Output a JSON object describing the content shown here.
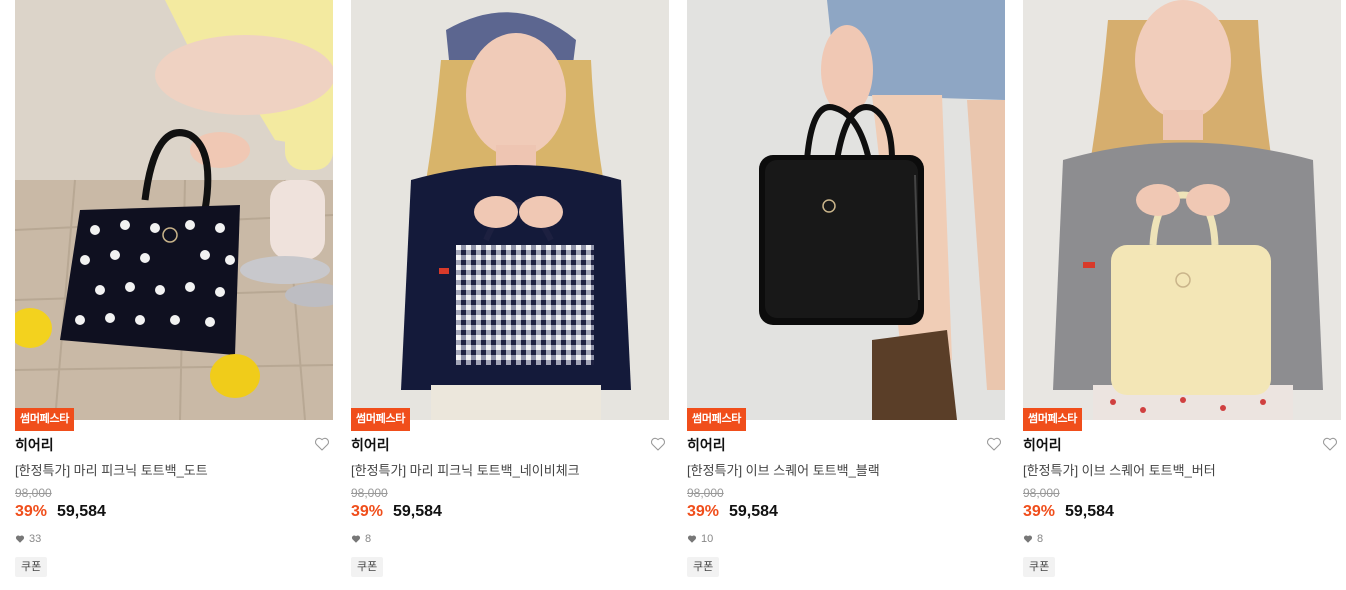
{
  "products": [
    {
      "badge": "썸머페스타",
      "brand": "히어리",
      "name": "[한정특가] 마리 피크닉 토트백_도트",
      "original_price": "98,000",
      "discount": "39%",
      "price": "59,584",
      "likes": "33",
      "coupon": "쿠폰",
      "image": "model crouching holding navy polka-dot tote bag with lemons on tile floor"
    },
    {
      "badge": "썸머페스타",
      "brand": "히어리",
      "name": "[한정특가] 마리 피크닉 토트백_네이비체크",
      "original_price": "98,000",
      "discount": "39%",
      "price": "59,584",
      "likes": "8",
      "coupon": "쿠폰",
      "image": "winking model in navy cardigan holding gingham check tote bag"
    },
    {
      "badge": "썸머페스타",
      "brand": "히어리",
      "name": "[한정특가] 이브 스퀘어 토트백_블랙",
      "original_price": "98,000",
      "discount": "39%",
      "price": "59,584",
      "likes": "10",
      "coupon": "쿠폰",
      "image": "hand holding black square leather tote bag beside legs in denim skirt and boots"
    },
    {
      "badge": "썸머페스타",
      "brand": "히어리",
      "name": "[한정특가] 이브 스퀘어 토트백_버터",
      "original_price": "98,000",
      "discount": "39%",
      "price": "59,584",
      "likes": "8",
      "coupon": "쿠폰",
      "image": "model in grey cardigan holding butter yellow square tote bag"
    }
  ],
  "colors": {
    "accent": "#f04e1b",
    "text": "#111111",
    "muted": "#999999"
  },
  "icons": {
    "like": "heart-outline-icon",
    "like_count": "heart-filled-icon"
  }
}
